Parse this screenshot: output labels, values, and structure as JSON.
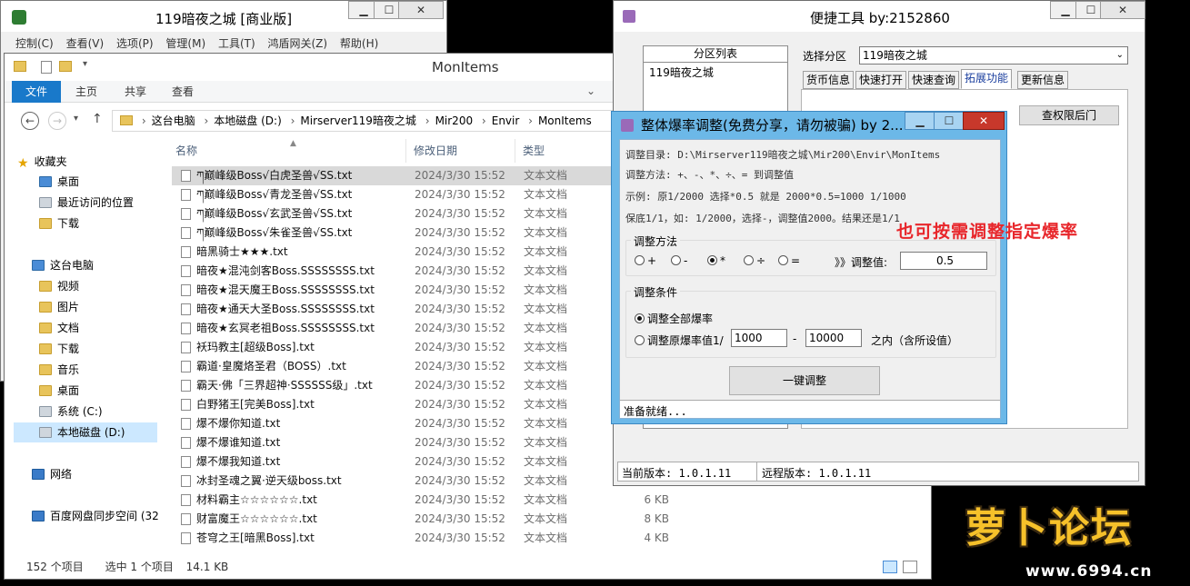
{
  "w1": {
    "title": "119暗夜之城 [商业版]",
    "menu": [
      "控制(C)",
      "查看(V)",
      "选项(P)",
      "管理(M)",
      "工具(T)",
      "鸿盾网关(Z)",
      "帮助(H)"
    ]
  },
  "explorer": {
    "title": "MonItems",
    "ribbon": [
      "文件",
      "主页",
      "共享",
      "查看"
    ],
    "breadcrumb": [
      "这台电脑",
      "本地磁盘 (D:)",
      "Mirserver119暗夜之城",
      "Mir200",
      "Envir",
      "MonItems"
    ],
    "nav": {
      "favorites": "收藏夹",
      "desktop": "桌面",
      "recent": "最近访问的位置",
      "downloads": "下载",
      "thispc": "这台电脑",
      "videos": "视频",
      "pictures": "图片",
      "documents": "文档",
      "downloads2": "下载",
      "music": "音乐",
      "desktop2": "桌面",
      "sysc": "系统 (C:)",
      "locald": "本地磁盘 (D:)",
      "network": "网络",
      "baidu": "百度网盘同步空间 (32"
    },
    "columns": {
      "name": "名称",
      "date": "修改日期",
      "type": "类型"
    },
    "files": [
      {
        "name": "ཀ巅峰级Boss√白虎圣兽√SS.txt",
        "date": "2024/3/30 15:52",
        "type": "文本文档",
        "size": ""
      },
      {
        "name": "ཀ巅峰级Boss√青龙圣兽√SS.txt",
        "date": "2024/3/30 15:52",
        "type": "文本文档",
        "size": ""
      },
      {
        "name": "ཀ巅峰级Boss√玄武圣兽√SS.txt",
        "date": "2024/3/30 15:52",
        "type": "文本文档",
        "size": ""
      },
      {
        "name": "ཀ巅峰级Boss√朱雀圣兽√SS.txt",
        "date": "2024/3/30 15:52",
        "type": "文本文档",
        "size": ""
      },
      {
        "name": "暗黑骑士★★★.txt",
        "date": "2024/3/30 15:52",
        "type": "文本文档",
        "size": ""
      },
      {
        "name": "暗夜★混沌剑客Boss.SSSSSSSS.txt",
        "date": "2024/3/30 15:52",
        "type": "文本文档",
        "size": ""
      },
      {
        "name": "暗夜★混天魔王Boss.SSSSSSSS.txt",
        "date": "2024/3/30 15:52",
        "type": "文本文档",
        "size": ""
      },
      {
        "name": "暗夜★通天大圣Boss.SSSSSSSS.txt",
        "date": "2024/3/30 15:52",
        "type": "文本文档",
        "size": ""
      },
      {
        "name": "暗夜★玄冥老祖Boss.SSSSSSSS.txt",
        "date": "2024/3/30 15:52",
        "type": "文本文档",
        "size": ""
      },
      {
        "name": "袄玛教主[超级Boss].txt",
        "date": "2024/3/30 15:52",
        "type": "文本文档",
        "size": ""
      },
      {
        "name": "霸道·皇魔烙圣君（BOSS）.txt",
        "date": "2024/3/30 15:52",
        "type": "文本文档",
        "size": ""
      },
      {
        "name": "霸天·佛「三界超神·SSSSSS级」.txt",
        "date": "2024/3/30 15:52",
        "type": "文本文档",
        "size": ""
      },
      {
        "name": "白野猪王[完美Boss].txt",
        "date": "2024/3/30 15:52",
        "type": "文本文档",
        "size": ""
      },
      {
        "name": "爆不爆你知道.txt",
        "date": "2024/3/30 15:52",
        "type": "文本文档",
        "size": ""
      },
      {
        "name": "爆不爆谁知道.txt",
        "date": "2024/3/30 15:52",
        "type": "文本文档",
        "size": ""
      },
      {
        "name": "爆不爆我知道.txt",
        "date": "2024/3/30 15:52",
        "type": "文本文档",
        "size": ""
      },
      {
        "name": "冰封圣魂之翼·逆天级boss.txt",
        "date": "2024/3/30 15:52",
        "type": "文本文档",
        "size": ""
      },
      {
        "name": "材料霸主☆☆☆☆☆☆.txt",
        "date": "2024/3/30 15:52",
        "type": "文本文档",
        "size": "6 KB"
      },
      {
        "name": "财富魔王☆☆☆☆☆☆.txt",
        "date": "2024/3/30 15:52",
        "type": "文本文档",
        "size": "8 KB"
      },
      {
        "name": "苍穹之王[暗黑Boss].txt",
        "date": "2024/3/30 15:52",
        "type": "文本文档",
        "size": "4 KB"
      }
    ],
    "status": {
      "count": "152 个项目",
      "selected": "选中 1 个项目",
      "size": "14.1 KB"
    }
  },
  "tool": {
    "title": "便捷工具  by:2152860",
    "partition_list_label": "分区列表",
    "partition_item": "119暗夜之城",
    "select_label": "选择分区",
    "select_value": "119暗夜之城",
    "tabs": [
      "货币信息",
      "快速打开",
      "快速查询",
      "拓展功能",
      "更新信息"
    ],
    "btn_check": "查权限后门",
    "version_local": "当前版本: 1.0.1.11",
    "version_remote": "远程版本: 1.0.1.11"
  },
  "dialog": {
    "title": "整体爆率调整(免费分享，请勿被骗)    by 2...",
    "dir": "调整目录: D:\\Mirserver119暗夜之城\\Mir200\\Envir\\MonItems",
    "method_desc": "调整方法: +、-、*、÷、=   到调整值",
    "example": "示例: 原1/2000 选择*0.5 就是 2000*0.5=1000  1/1000",
    "floor": "保底1/1，如: 1/2000，选择-，调整值2000。结果还是1/1",
    "method_group": "调整方法",
    "ops": [
      "+",
      "-",
      "*",
      "÷",
      "="
    ],
    "value_label": "》》调整值:",
    "value": "0.5",
    "cond_group": "调整条件",
    "opt_all": "调整全部爆率",
    "opt_range": "调整原爆率值1/",
    "range_from": "1000",
    "range_to": "10000",
    "range_suffix": "之内（含所设值）",
    "dash": "-",
    "apply": "一键调整",
    "status": "准备就绪..."
  },
  "annotation": "也可按需调整指定爆率",
  "logo": {
    "text": "萝卜论坛",
    "url": "www.6994.cn"
  }
}
